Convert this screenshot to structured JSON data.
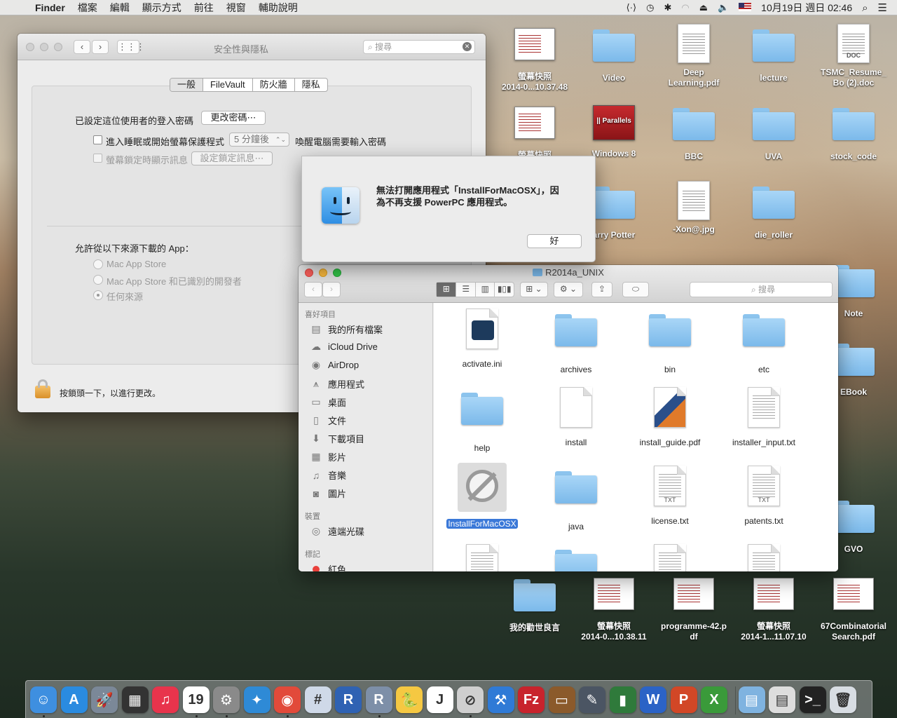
{
  "menubar": {
    "apple": "",
    "items": [
      "Finder",
      "檔案",
      "編輯",
      "顯示方式",
      "前往",
      "視窗",
      "輔助說明"
    ],
    "clock": "10月19日 週日 02:46"
  },
  "desktop": {
    "icons": [
      {
        "name": "screenshot-1",
        "label": "螢幕快照\n2014-0...10.37.48",
        "kind": "shot"
      },
      {
        "name": "video",
        "label": "Video",
        "kind": "folder"
      },
      {
        "name": "deep-learning",
        "label": "Deep\nLearning.pdf",
        "kind": "doc"
      },
      {
        "name": "lecture",
        "label": "lecture",
        "kind": "folder"
      },
      {
        "name": "tsmc-resume",
        "label": "TSMC_Resume_\nBo (2).doc",
        "kind": "doc",
        "tag": "DOC"
      },
      {
        "name": "screenshot-2",
        "label": "螢幕快照",
        "kind": "shot"
      },
      {
        "name": "windows-8",
        "label": "Windows 8",
        "kind": "parallels",
        "tag": "|| Parallels"
      },
      {
        "name": "bbc",
        "label": "BBC",
        "kind": "folder"
      },
      {
        "name": "uva",
        "label": "UVA",
        "kind": "folder"
      },
      {
        "name": "stock-code",
        "label": "stock_code",
        "kind": "folder"
      },
      {
        "name": "harry-potter",
        "label": "arry Potter",
        "kind": "folder"
      },
      {
        "name": "xon-jpg",
        "label": "-Xon@.jpg",
        "kind": "doc"
      },
      {
        "name": "die-roller",
        "label": "die_roller",
        "kind": "folder"
      },
      {
        "name": "note",
        "label": "Note",
        "kind": "folder"
      },
      {
        "name": "ebook",
        "label": "EBook",
        "kind": "folder"
      },
      {
        "name": "gvo",
        "label": "GVO",
        "kind": "folder"
      },
      {
        "name": "motto",
        "label": "我的勸世良言",
        "kind": "folder"
      },
      {
        "name": "screenshot-3",
        "label": "螢幕快照\n2014-0...10.38.11",
        "kind": "shot"
      },
      {
        "name": "programme-42",
        "label": "programme-42.p\ndf",
        "kind": "shot"
      },
      {
        "name": "screenshot-4",
        "label": "螢幕快照\n2014-1...11.07.10",
        "kind": "shot"
      },
      {
        "name": "combinatorial-search",
        "label": "67Combinatorial\nSearch.pdf",
        "kind": "shot"
      }
    ]
  },
  "security": {
    "title": "安全性與隱私",
    "search_placeholder": "搜尋",
    "tabs": [
      "一般",
      "FileVault",
      "防火牆",
      "隱私"
    ],
    "login_password_label": "已設定這位使用者的登入密碼",
    "change_password_button": "更改密碼⋯",
    "sleep_checkbox_label": "進入睡眠或開始螢幕保護程式",
    "sleep_delay_value": "5 分鐘後",
    "sleep_suffix": "喚醒電腦需要輸入密碼",
    "lock_message_label": "螢幕鎖定時顯示訊息",
    "set_lock_message_button": "設定鎖定訊息⋯",
    "allow_apps_label": "允許從以下來源下載的 App：",
    "sources": [
      "Mac App Store",
      "Mac App Store 和已識別的開發者",
      "任何來源"
    ],
    "lock_text": "按鎖頭一下，以進行更改。"
  },
  "alert": {
    "message_line1": "無法打開應用程式「InstallForMacOSX」，因",
    "message_line2": "為不再支援 PowerPC 應用程式。",
    "ok_button": "好"
  },
  "finder": {
    "title": "R2014a_UNIX",
    "search_placeholder": "搜尋",
    "sidebar": {
      "favorites_header": "喜好項目",
      "favorites": [
        {
          "label": "我的所有檔案",
          "icon": "all-files-icon",
          "glyph": "▤"
        },
        {
          "label": "iCloud Drive",
          "icon": "cloud-icon",
          "glyph": "☁"
        },
        {
          "label": "AirDrop",
          "icon": "airdrop-icon",
          "glyph": "◉"
        },
        {
          "label": "應用程式",
          "icon": "applications-icon",
          "glyph": "⩚"
        },
        {
          "label": "桌面",
          "icon": "desktop-icon",
          "glyph": "▭"
        },
        {
          "label": "文件",
          "icon": "documents-icon",
          "glyph": "▯"
        },
        {
          "label": "下載項目",
          "icon": "downloads-icon",
          "glyph": "⬇"
        },
        {
          "label": "影片",
          "icon": "movies-icon",
          "glyph": "▦"
        },
        {
          "label": "音樂",
          "icon": "music-icon",
          "glyph": "♫"
        },
        {
          "label": "圖片",
          "icon": "pictures-icon",
          "glyph": "◙"
        }
      ],
      "devices_header": "裝置",
      "devices": [
        {
          "label": "遠端光碟",
          "icon": "remote-disc-icon",
          "glyph": "◎"
        }
      ],
      "tags_header": "標記",
      "tags": [
        {
          "label": "紅色",
          "color": "#e9403b"
        }
      ]
    },
    "files": [
      {
        "label": "activate.ini",
        "kind": "ini"
      },
      {
        "label": "archives",
        "kind": "folder"
      },
      {
        "label": "bin",
        "kind": "folder"
      },
      {
        "label": "etc",
        "kind": "folder"
      },
      {
        "label": "help",
        "kind": "folder"
      },
      {
        "label": "install",
        "kind": "blank"
      },
      {
        "label": "install_guide.pdf",
        "kind": "pdf"
      },
      {
        "label": "installer_input.txt",
        "kind": "txt"
      },
      {
        "label": "InstallForMacOSX",
        "kind": "app",
        "selected": true
      },
      {
        "label": "java",
        "kind": "folder"
      },
      {
        "label": "license.txt",
        "kind": "txt",
        "tag": "TXT"
      },
      {
        "label": "patents.txt",
        "kind": "txt",
        "tag": "TXT"
      }
    ]
  },
  "dock": {
    "apps": [
      {
        "name": "finder",
        "color": "#3e8fe0",
        "glyph": "☺"
      },
      {
        "name": "app-store",
        "color": "#2a8be0",
        "glyph": "A"
      },
      {
        "name": "launchpad",
        "color": "#7b8898",
        "glyph": "🚀"
      },
      {
        "name": "activity-monitor",
        "color": "#333333",
        "glyph": "▦"
      },
      {
        "name": "itunes",
        "color": "#e8344c",
        "glyph": "♫"
      },
      {
        "name": "calendar",
        "color": "#ffffff",
        "glyph": "19"
      },
      {
        "name": "system-preferences",
        "color": "#8a8a8a",
        "glyph": "⚙"
      },
      {
        "name": "safari",
        "color": "#2e8ad6",
        "glyph": "✦"
      },
      {
        "name": "chrome",
        "color": "#e24a3a",
        "glyph": "◉"
      },
      {
        "name": "keynote",
        "color": "#cfd9e8",
        "glyph": "#"
      },
      {
        "name": "r",
        "color": "#2f62b3",
        "glyph": "R"
      },
      {
        "name": "rstudio",
        "color": "#7d8fa8",
        "glyph": "R"
      },
      {
        "name": "python",
        "color": "#f5c842",
        "glyph": "🐍"
      },
      {
        "name": "jupyter",
        "color": "#ffffff",
        "glyph": "J"
      },
      {
        "name": "install-for-macosx",
        "color": "#cfcfcf",
        "glyph": "⊘"
      },
      {
        "name": "xcode",
        "color": "#2f7ad6",
        "glyph": "⚒"
      },
      {
        "name": "filezilla",
        "color": "#c8232c",
        "glyph": "Fz"
      },
      {
        "name": "presentation",
        "color": "#8b5a2b",
        "glyph": "▭"
      },
      {
        "name": "utilities",
        "color": "#4b5563",
        "glyph": "✎"
      },
      {
        "name": "excel-chart",
        "color": "#2f7a3b",
        "glyph": "▮"
      },
      {
        "name": "word",
        "color": "#2b63c6",
        "glyph": "W"
      },
      {
        "name": "powerpoint",
        "color": "#d24726",
        "glyph": "P"
      },
      {
        "name": "excel",
        "color": "#3a9a3a",
        "glyph": "X"
      },
      {
        "name": "applications-folder",
        "color": "#7fb3e0",
        "glyph": "▤"
      },
      {
        "name": "documents-stack",
        "color": "#dddddd",
        "glyph": "▤"
      },
      {
        "name": "terminal-stack",
        "color": "#222222",
        "glyph": ">_"
      },
      {
        "name": "trash",
        "color": "#d8dde3",
        "glyph": "🗑"
      }
    ]
  }
}
